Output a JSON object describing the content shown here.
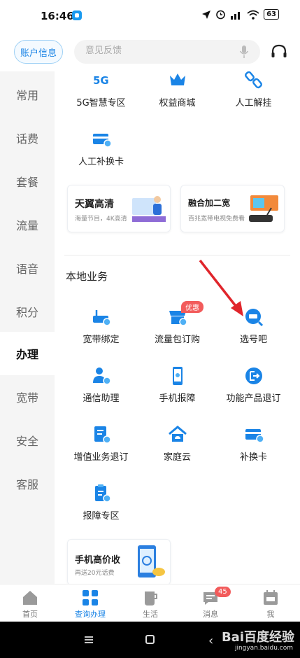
{
  "status": {
    "time": "16:46",
    "battery": "63"
  },
  "header": {
    "account_label": "账户信息",
    "search_placeholder": "意见反馈"
  },
  "sidebar": {
    "items": [
      {
        "label": "常用"
      },
      {
        "label": "话费"
      },
      {
        "label": "套餐"
      },
      {
        "label": "流量"
      },
      {
        "label": "语音"
      },
      {
        "label": "积分"
      },
      {
        "label": "办理"
      },
      {
        "label": "宽带"
      },
      {
        "label": "安全"
      },
      {
        "label": "客服"
      }
    ],
    "active_index": 6
  },
  "top_services": [
    {
      "label": "5G智慧专区",
      "icon": "5g-icon"
    },
    {
      "label": "权益商城",
      "icon": "crown-icon"
    },
    {
      "label": "人工解挂",
      "icon": "unlink-icon"
    },
    {
      "label": "人工补换卡",
      "icon": "card-icon"
    }
  ],
  "banners": [
    {
      "title": "天翼高清",
      "subtitle": "海量节目，4K高清"
    },
    {
      "title": "融合加二宽",
      "subtitle": "百兆宽带电视免费看"
    }
  ],
  "local": {
    "title": "本地业务",
    "services": [
      {
        "label": "宽带绑定",
        "icon": "router-icon"
      },
      {
        "label": "流量包订购",
        "icon": "shop-icon",
        "badge": "优惠"
      },
      {
        "label": "选号吧",
        "icon": "search-number-icon"
      },
      {
        "label": "通信助理",
        "icon": "assistant-icon"
      },
      {
        "label": "手机报障",
        "icon": "phone-icon"
      },
      {
        "label": "功能产品退订",
        "icon": "exit-icon"
      },
      {
        "label": "增值业务退订",
        "icon": "doc-cancel-icon"
      },
      {
        "label": "家庭云",
        "icon": "home-cloud-icon"
      },
      {
        "label": "补换卡",
        "icon": "card-icon"
      },
      {
        "label": "报障专区",
        "icon": "clipboard-icon"
      }
    ]
  },
  "bottom_banner": {
    "title": "手机高价收",
    "subtitle": "再送20元话费"
  },
  "bottom_nav": [
    {
      "label": "首页"
    },
    {
      "label": "查询办理"
    },
    {
      "label": "生活"
    },
    {
      "label": "消息",
      "count": "45"
    },
    {
      "label": "我"
    }
  ],
  "watermark": {
    "brand": "Bai百度经验",
    "url": "jingyan.baidu.com"
  },
  "colors": {
    "accent": "#1a84e6",
    "badge": "#f25b5b",
    "arrow": "#e0252b"
  }
}
